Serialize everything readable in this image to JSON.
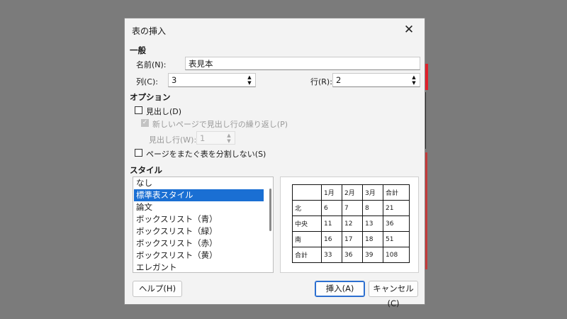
{
  "dialog": {
    "title": "表の挿入",
    "close_glyph": "✕",
    "general": {
      "heading": "一般",
      "name_label": "名前(N):",
      "name_value": "表見本",
      "columns_label": "列(C):",
      "columns_value": "3",
      "rows_label": "行(R):",
      "rows_value": "2"
    },
    "options": {
      "heading": "オプション",
      "heading_checkbox": {
        "label": "見出し(D)",
        "checked": false
      },
      "repeat_heading": {
        "label": "新しいページで見出し行の繰り返し(P)",
        "checked": true,
        "disabled": true
      },
      "heading_rows_label": "見出し行(W):",
      "heading_rows_value": "1",
      "dont_split": {
        "label": "ページをまたぐ表を分割しない(S)",
        "checked": false
      }
    },
    "styles": {
      "heading": "スタイル",
      "items": [
        "なし",
        "標準表スタイル",
        "論文",
        "ボックスリスト（青）",
        "ボックスリスト（緑）",
        "ボックスリスト（赤）",
        "ボックスリスト（黄）",
        "エレガント"
      ],
      "selected": "標準表スタイル"
    },
    "preview": {
      "rows": [
        [
          "",
          "1月",
          "2月",
          "3月",
          "合計"
        ],
        [
          "北",
          "6",
          "7",
          "8",
          "21"
        ],
        [
          "中央",
          "11",
          "12",
          "13",
          "36"
        ],
        [
          "南",
          "16",
          "17",
          "18",
          "51"
        ],
        [
          "合計",
          "33",
          "36",
          "39",
          "108"
        ]
      ]
    },
    "buttons": {
      "help": "ヘルプ(H)",
      "insert": "挿入(A)",
      "cancel": "キャンセル(C)"
    }
  }
}
